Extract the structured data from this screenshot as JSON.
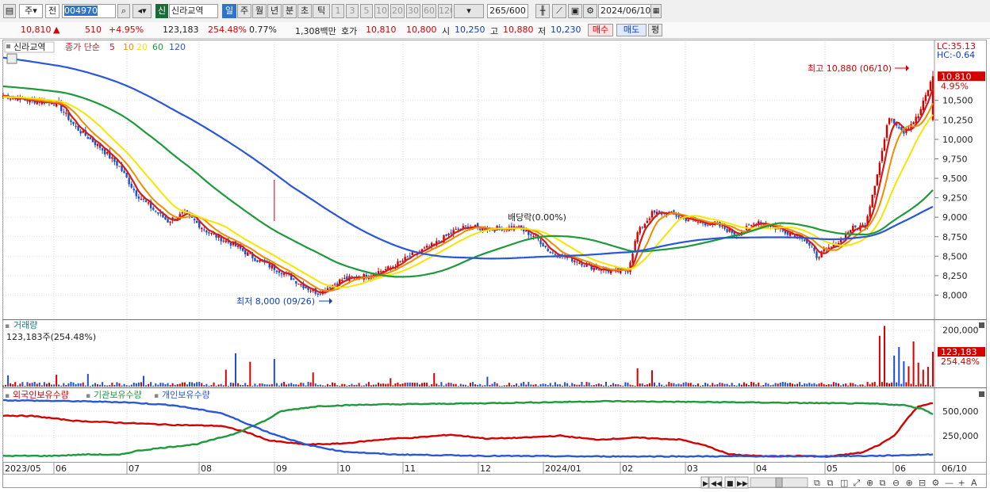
{
  "toolbar": {
    "market_type": "주",
    "prev_label": "전",
    "code": "004970",
    "badge": "신",
    "name": "신라교역",
    "periods": [
      "일",
      "주",
      "월",
      "년",
      "분",
      "초",
      "틱"
    ],
    "active_period": "일",
    "intervals": [
      "1",
      "3",
      "5",
      "10",
      "20",
      "30",
      "60",
      "120"
    ],
    "count": "265",
    "count_total": "/600",
    "date": "2024/06/10"
  },
  "quote": {
    "price": "10,810",
    "arrow": "▲",
    "change": "510",
    "change_pct": "+4.95%",
    "volume": "123,183",
    "volume_ratio": "254.48%",
    "turnover": "0.77%",
    "amount": "1,308백만",
    "hoga_label": "호가",
    "ask": "10,810",
    "bid": "10,800",
    "open_label": "시",
    "open": "10,250",
    "high_label": "고",
    "high": "10,880",
    "low_label": "저",
    "low": "10,230",
    "buy_btn": "매수",
    "sell_btn": "매도",
    "eval_btn": "평"
  },
  "colors": {
    "up": "#d40000",
    "down": "#1f4fd0",
    "ma5": "#d41c1c",
    "ma10": "#f08c00",
    "ma20": "#f5e600",
    "ma60": "#1e9a3c",
    "ma120": "#2a56d8"
  },
  "chart_data": [
    {
      "type": "candlestick",
      "title": "신라교역",
      "legend": {
        "prefix": "종가 단순",
        "items": [
          "5",
          "10",
          "20",
          "60",
          "120"
        ]
      },
      "lc_label": "LC:35.13",
      "hc_label": "HC:-0.64",
      "ylim": [
        7700,
        11250
      ],
      "y_ticks": [
        8000,
        8250,
        8500,
        8750,
        9000,
        9250,
        9500,
        9750,
        10000,
        10250,
        10500
      ],
      "y_tick_labels": [
        "8,000",
        "8,250",
        "8,500",
        "8,750",
        "9,000",
        "9,250",
        "9,500",
        "9,750",
        "10,000",
        "10,250",
        "10,500"
      ],
      "current_price_label": "10,810",
      "current_pct_label": "4.95%",
      "current_price": 10810,
      "annotations": {
        "high": "최고 10,880 (06/10)",
        "low": "최저 8,000 (09/26)",
        "dividend": "배당락(0.00%)"
      },
      "anchors": [
        [
          0,
          10560
        ],
        [
          10,
          10500
        ],
        [
          22,
          10470
        ],
        [
          30,
          10150
        ],
        [
          40,
          9900
        ],
        [
          48,
          9650
        ],
        [
          55,
          9300
        ],
        [
          62,
          9100
        ],
        [
          68,
          8950
        ],
        [
          75,
          9050
        ],
        [
          85,
          8800
        ],
        [
          95,
          8650
        ],
        [
          105,
          8450
        ],
        [
          115,
          8300
        ],
        [
          125,
          8100
        ],
        [
          130,
          8030
        ],
        [
          140,
          8200
        ],
        [
          150,
          8250
        ],
        [
          160,
          8350
        ],
        [
          168,
          8500
        ],
        [
          178,
          8650
        ],
        [
          186,
          8820
        ],
        [
          192,
          8880
        ],
        [
          200,
          8850
        ],
        [
          212,
          8870
        ],
        [
          220,
          8750
        ],
        [
          226,
          8550
        ],
        [
          236,
          8450
        ],
        [
          244,
          8350
        ],
        [
          252,
          8300
        ],
        [
          258,
          8320
        ],
        [
          262,
          8800
        ],
        [
          268,
          9050
        ],
        [
          275,
          9050
        ],
        [
          285,
          8950
        ],
        [
          295,
          8900
        ],
        [
          303,
          8780
        ],
        [
          312,
          8950
        ],
        [
          320,
          8850
        ],
        [
          330,
          8750
        ],
        [
          336,
          8500
        ],
        [
          344,
          8650
        ],
        [
          350,
          8850
        ],
        [
          356,
          8900
        ],
        [
          362,
          9700
        ],
        [
          366,
          10300
        ],
        [
          372,
          10100
        ],
        [
          378,
          10300
        ],
        [
          384,
          10810
        ]
      ],
      "ma_start": [
        {
          "name": "5",
          "value": 10560
        },
        {
          "name": "10",
          "value": 10550
        },
        {
          "name": "20",
          "value": 10540
        },
        {
          "name": "60",
          "value": 10680
        },
        {
          "name": "120",
          "value": 11050
        }
      ]
    },
    {
      "type": "bar",
      "title": "거래량",
      "value_label": "123,183주(254.48%)",
      "y_ticks": [
        100000,
        200000
      ],
      "y_tick_labels": [
        "",
        "200,000"
      ],
      "last_value_label": "123,183",
      "last_pct_label": "254.48%",
      "ylim": [
        0,
        230000
      ],
      "baseline": 9000,
      "spikes": [
        [
          2,
          40000
        ],
        [
          22,
          42000
        ],
        [
          35,
          45000
        ],
        [
          58,
          38000
        ],
        [
          92,
          60000
        ],
        [
          96,
          118000
        ],
        [
          102,
          88000
        ],
        [
          112,
          98000
        ],
        [
          128,
          50000
        ],
        [
          160,
          30000
        ],
        [
          178,
          48000
        ],
        [
          200,
          35000
        ],
        [
          262,
          65000
        ],
        [
          268,
          58000
        ],
        [
          362,
          180000
        ],
        [
          364,
          215000
        ],
        [
          368,
          110000
        ],
        [
          370,
          140000
        ],
        [
          372,
          90000
        ],
        [
          374,
          72000
        ],
        [
          376,
          160000
        ],
        [
          378,
          85000
        ],
        [
          380,
          60000
        ],
        [
          382,
          70000
        ],
        [
          384,
          123183
        ]
      ]
    },
    {
      "type": "line",
      "title": [
        "외국인보유수량",
        "기관보유수량",
        "개인보유수량"
      ],
      "y_ticks": [
        250000,
        500000
      ],
      "y_tick_labels": [
        "250,000",
        "500,000"
      ],
      "ylim": [
        0,
        700000
      ],
      "series": [
        {
          "name": "외국인보유수량",
          "color": "#d40000",
          "anchors": [
            [
              0,
              455000
            ],
            [
              12,
              450000
            ],
            [
              30,
              400000
            ],
            [
              50,
              380000
            ],
            [
              70,
              360000
            ],
            [
              90,
              350000
            ],
            [
              100,
              290000
            ],
            [
              110,
              200000
            ],
            [
              125,
              160000
            ],
            [
              140,
              170000
            ],
            [
              160,
              220000
            ],
            [
              170,
              230000
            ],
            [
              185,
              260000
            ],
            [
              200,
              220000
            ],
            [
              215,
              230000
            ],
            [
              230,
              250000
            ],
            [
              245,
              210000
            ],
            [
              262,
              230000
            ],
            [
              280,
              210000
            ],
            [
              290,
              150000
            ],
            [
              300,
              60000
            ],
            [
              315,
              40000
            ],
            [
              330,
              45000
            ],
            [
              340,
              35000
            ],
            [
              355,
              80000
            ],
            [
              362,
              160000
            ],
            [
              368,
              250000
            ],
            [
              374,
              440000
            ],
            [
              378,
              550000
            ],
            [
              384,
              580000
            ]
          ]
        },
        {
          "name": "기관보유수량",
          "color": "#1e9a3c",
          "anchors": [
            [
              0,
              45000
            ],
            [
              20,
              45000
            ],
            [
              35,
              60000
            ],
            [
              48,
              55000
            ],
            [
              55,
              95000
            ],
            [
              65,
              125000
            ],
            [
              80,
              165000
            ],
            [
              95,
              265000
            ],
            [
              108,
              400000
            ],
            [
              115,
              500000
            ],
            [
              130,
              550000
            ],
            [
              150,
              565000
            ],
            [
              200,
              580000
            ],
            [
              250,
              600000
            ],
            [
              300,
              590000
            ],
            [
              340,
              580000
            ],
            [
              360,
              575000
            ],
            [
              372,
              560000
            ],
            [
              380,
              520000
            ],
            [
              384,
              470000
            ]
          ]
        },
        {
          "name": "개인보유수량",
          "color": "#2a56d8",
          "anchors": [
            [
              0,
              610000
            ],
            [
              30,
              600000
            ],
            [
              50,
              590000
            ],
            [
              70,
              560000
            ],
            [
              90,
              480000
            ],
            [
              100,
              380000
            ],
            [
              110,
              280000
            ],
            [
              125,
              160000
            ],
            [
              140,
              90000
            ],
            [
              160,
              60000
            ],
            [
              200,
              45000
            ],
            [
              240,
              40000
            ],
            [
              280,
              40000
            ],
            [
              330,
              42000
            ],
            [
              360,
              45000
            ],
            [
              384,
              60000
            ]
          ]
        }
      ]
    }
  ],
  "x_axis": {
    "labels": [
      "2023/05",
      "06",
      "07",
      "08",
      "09",
      "10",
      "11",
      "12",
      "2024/01",
      "02",
      "03",
      "04",
      "05",
      "06"
    ],
    "end_label": "06/10"
  }
}
